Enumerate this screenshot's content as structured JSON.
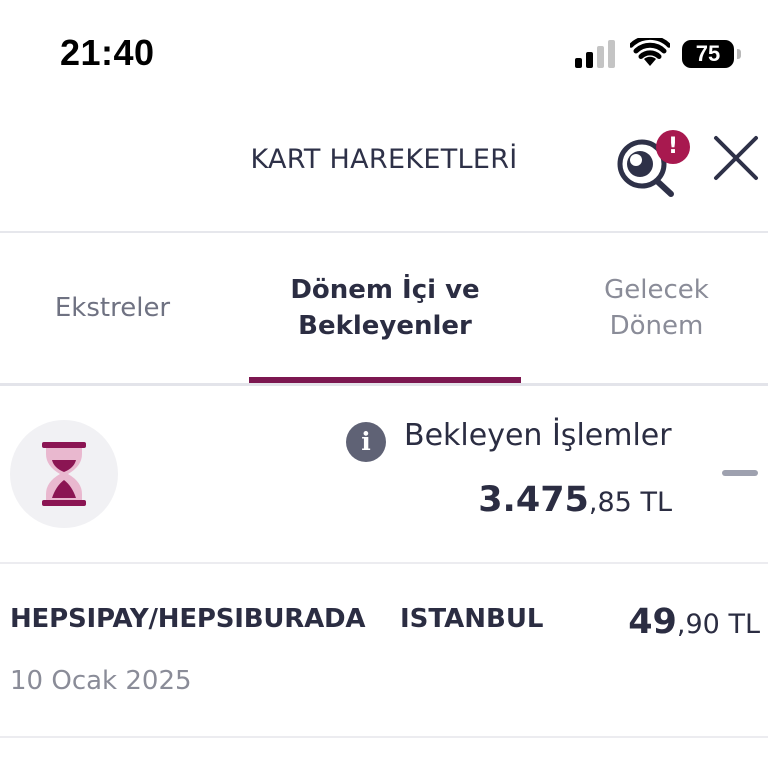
{
  "status_bar": {
    "time": "21:40",
    "battery_level": "75",
    "signal_bars_active": 2,
    "signal_bars_total": 4
  },
  "header": {
    "title": "KART HAREKETLERİ",
    "search_icon": "search-alert-icon",
    "close_icon": "close-icon",
    "alert_badge": "!"
  },
  "tabs": [
    {
      "label": "Ekstreler",
      "active": false
    },
    {
      "label": "Dönem İçi ve Bekleyenler",
      "active": true
    },
    {
      "label": "Gelecek Dönem",
      "active": false
    }
  ],
  "pending": {
    "icon": "hourglass-icon",
    "info_icon": "info-icon",
    "info_glyph": "i",
    "title": "Bekleyen İşlemler",
    "amount_int": "3.475",
    "amount_dec": ",85",
    "currency": " TL"
  },
  "transactions": [
    {
      "merchant": "HEPSIPAY/HEPSIBURADA",
      "city": "ISTANBUL",
      "amount_int": "49",
      "amount_dec": ",90",
      "currency": " TL",
      "date": "10 Ocak 2025"
    }
  ],
  "colors": {
    "accent": "#7c1750",
    "badge": "#a8194f",
    "text_primary": "#2b2d42",
    "text_secondary": "#8a8c98",
    "hourglass": "#8b1553"
  }
}
